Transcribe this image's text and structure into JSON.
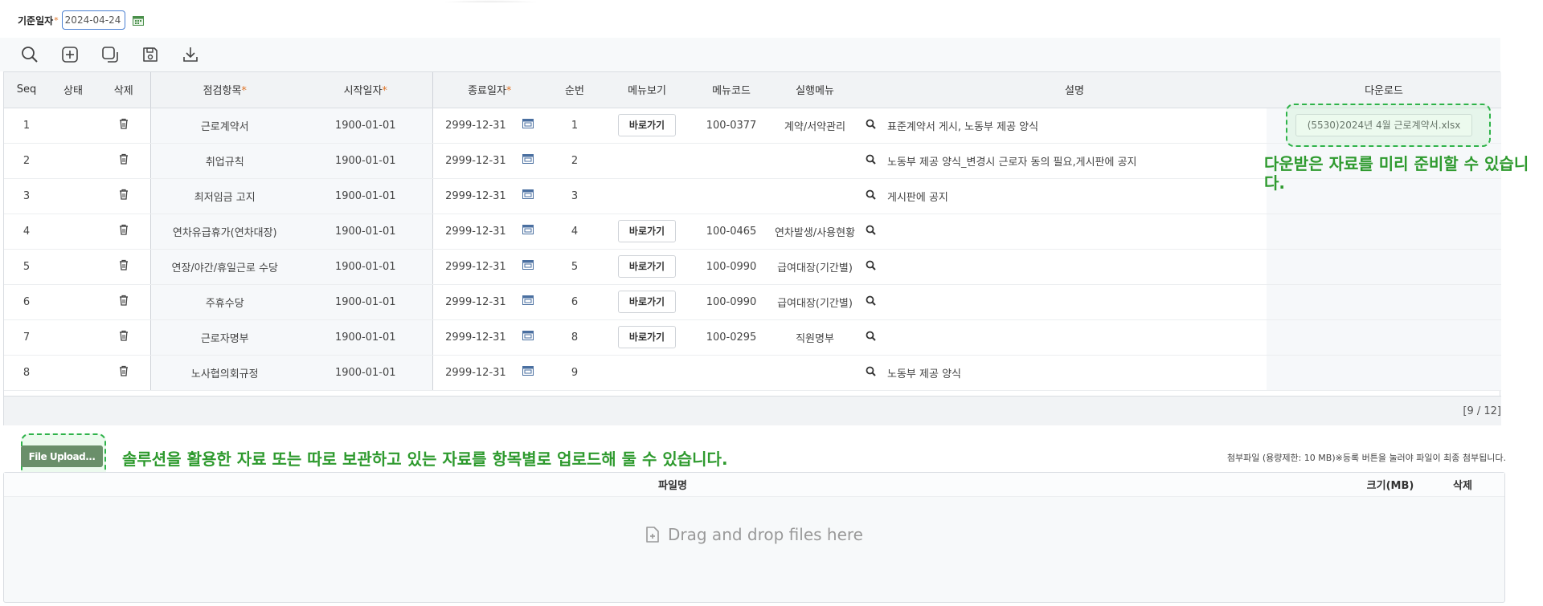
{
  "filter": {
    "date_label": "기준일자",
    "required_mark": "*",
    "date_value": "2024-04-24"
  },
  "toolbar": {
    "icons": [
      "search-icon",
      "add-icon",
      "copy-icon",
      "save-icon",
      "download-icon"
    ]
  },
  "grid": {
    "columns": [
      "Seq",
      "상태",
      "삭제",
      "점검항목",
      "시작일자",
      "종료일자",
      "순번",
      "메뉴보기",
      "메뉴코드",
      "실행메뉴",
      "",
      "설명",
      "다운로드"
    ],
    "required_mark": "*",
    "go_label": "바로가기",
    "rows": [
      {
        "seq": "1",
        "item": "근로계약서",
        "start": "1900-01-01",
        "end": "2999-12-31",
        "order": "1",
        "go": true,
        "code": "100-0377",
        "menu": "계약/서약관리",
        "desc": "표준계약서 게시, 노동부 제공 양식",
        "download": "(5530)2024년 4월 근로계약서.xlsx"
      },
      {
        "seq": "2",
        "item": "취업규칙",
        "start": "1900-01-01",
        "end": "2999-12-31",
        "order": "2",
        "go": false,
        "code": "",
        "menu": "",
        "desc": "노동부 제공 양식_변경시 근로자 동의 필요,게시판에 공지",
        "download": ""
      },
      {
        "seq": "3",
        "item": "최저임금 고지",
        "start": "1900-01-01",
        "end": "2999-12-31",
        "order": "3",
        "go": false,
        "code": "",
        "menu": "",
        "desc": "게시판에 공지",
        "download": ""
      },
      {
        "seq": "4",
        "item": "연차유급휴가(연차대장)",
        "start": "1900-01-01",
        "end": "2999-12-31",
        "order": "4",
        "go": true,
        "code": "100-0465",
        "menu": "연차발생/사용현황",
        "desc": "",
        "download": ""
      },
      {
        "seq": "5",
        "item": "연장/야간/휴일근로 수당",
        "start": "1900-01-01",
        "end": "2999-12-31",
        "order": "5",
        "go": true,
        "code": "100-0990",
        "menu": "급여대장(기간별)",
        "desc": "",
        "download": ""
      },
      {
        "seq": "6",
        "item": "주휴수당",
        "start": "1900-01-01",
        "end": "2999-12-31",
        "order": "6",
        "go": true,
        "code": "100-0990",
        "menu": "급여대장(기간별)",
        "desc": "",
        "download": ""
      },
      {
        "seq": "7",
        "item": "근로자명부",
        "start": "1900-01-01",
        "end": "2999-12-31",
        "order": "8",
        "go": true,
        "code": "100-0295",
        "menu": "직원명부",
        "desc": "",
        "download": ""
      },
      {
        "seq": "8",
        "item": "노사협의회규정",
        "start": "1900-01-01",
        "end": "2999-12-31",
        "order": "9",
        "go": false,
        "code": "",
        "menu": "",
        "desc": "노동부 제공 양식",
        "download": ""
      }
    ],
    "pager": "[9 / 12]"
  },
  "notes": {
    "download_note": "다운받은 자료를 미리 준비할 수 있습니다.",
    "upload_note": "솔루션을 활용한 자료 또는 따로 보관하고 있는 자료를 항목별로 업로드해 둘 수 있습니다."
  },
  "upload": {
    "button_label": "File Upload...",
    "attach_note": "첨부파일 (용량제한: 10 MB)※등록 버튼을 눌러야 파일이 최종 첨부됩니다.",
    "col_name": "파일명",
    "col_size": "크기(MB)",
    "col_delete": "삭제",
    "drop_text": "Drag and drop files here"
  },
  "colors": {
    "accent_green": "#2e9a2e",
    "required_orange": "#e0762a",
    "date_border": "#4a7fd1"
  }
}
